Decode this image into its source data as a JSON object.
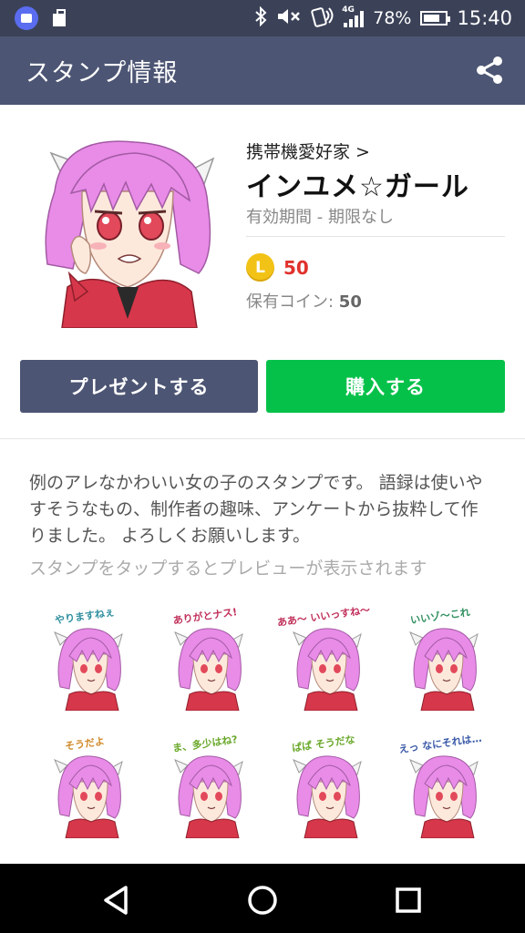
{
  "status_bar": {
    "network": "4G",
    "battery": "78%",
    "battery_level": 0.78,
    "time": "15:40",
    "icons": [
      "app-notification-icon",
      "clipboard-icon",
      "bluetooth-icon",
      "mute-icon",
      "nfc-icon",
      "signal-icon",
      "battery-icon"
    ]
  },
  "app_bar": {
    "title": "スタンプ情報",
    "share_icon": "share-icon"
  },
  "sticker_set": {
    "author": "携帯機愛好家 >",
    "title": "インユメ☆ガール",
    "validity": "有効期間 - 期限なし",
    "coin_symbol": "L",
    "price": "50",
    "owned_label": "保有コイン: ",
    "owned_value": "50"
  },
  "actions": {
    "present_label": "プレゼントする",
    "buy_label": "購入する"
  },
  "description": "例のアレなかわいい女の子のスタンプです。 語録は使いやすそうなもの、制作者の趣味、アンケートから抜粋して作りました。 よろしくお願いします。",
  "preview_hint": "スタンプをタップするとプレビューが表示されます",
  "stickers": [
    {
      "caption": "やりますねぇ"
    },
    {
      "caption": "ありがとナス!"
    },
    {
      "caption": "ああ〜 いいっすね〜"
    },
    {
      "caption": "いいゾ〜これ"
    },
    {
      "caption": "そうだよ"
    },
    {
      "caption": "ま、多少はね?"
    },
    {
      "caption": "ぱぱ そうだな"
    },
    {
      "caption": "えっ なにそれは…"
    }
  ],
  "colors": {
    "status_bar": "#3b4258",
    "app_bar": "#4c5573",
    "present_button": "#4c5573",
    "buy_button": "#06c149",
    "price": "#e0322c",
    "coin": "#f2c316"
  },
  "nav_bar": {
    "icons": [
      "back-icon",
      "home-icon",
      "recents-icon"
    ]
  }
}
